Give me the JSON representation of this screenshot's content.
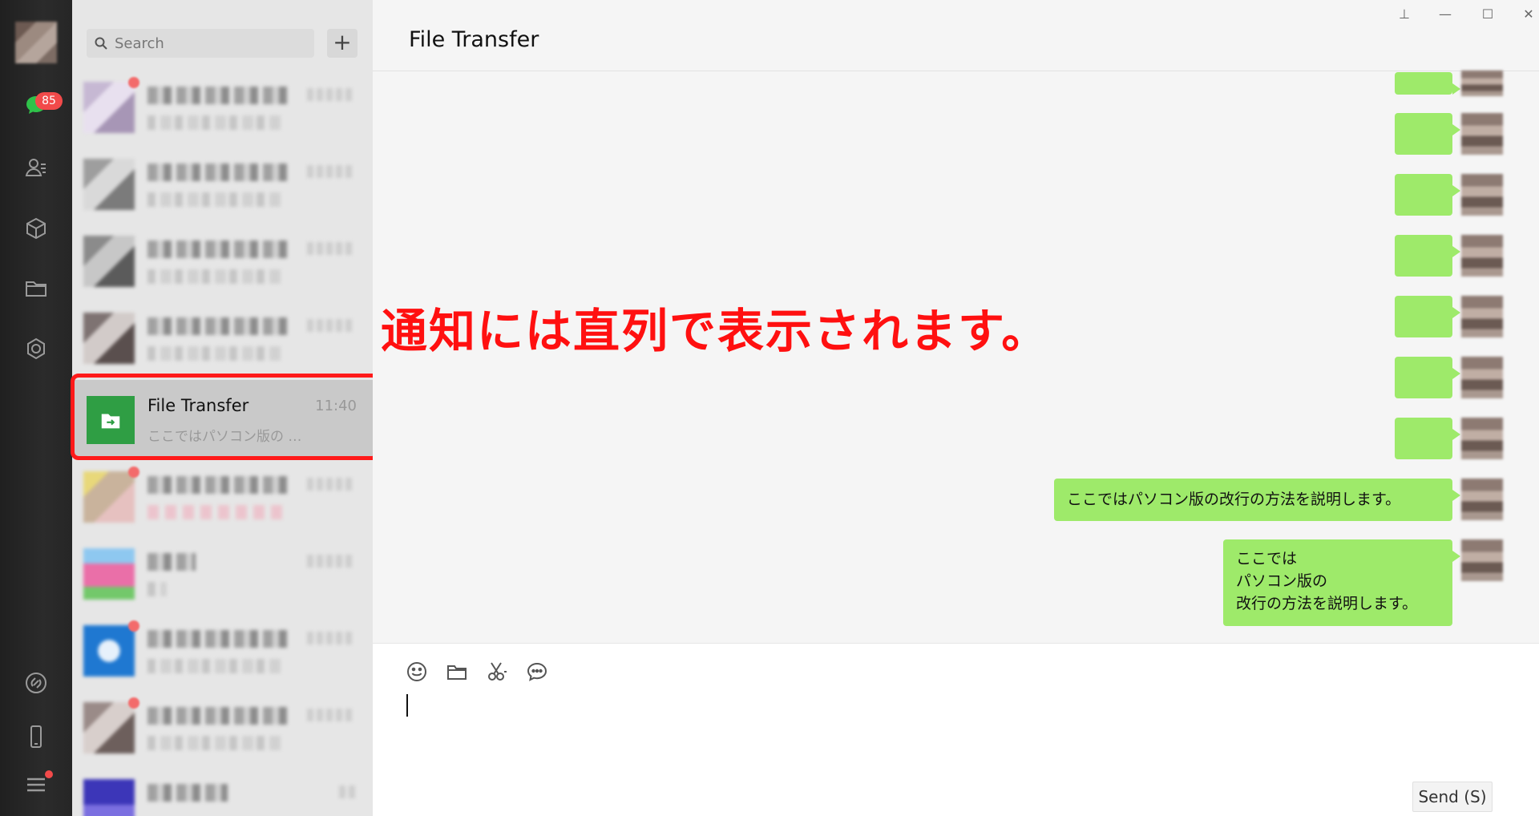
{
  "rail": {
    "unread_count": "85",
    "icons": [
      "chat-icon",
      "contacts-icon",
      "cube-icon",
      "folder-icon",
      "mini-program-icon",
      "link-icon",
      "phone-icon",
      "menu-icon"
    ]
  },
  "search": {
    "placeholder": "Search",
    "add_label": "+"
  },
  "chat_list": {
    "selected": {
      "name": "File Transfer",
      "time": "11:40",
      "preview": "ここではパソコン版の …"
    }
  },
  "chat": {
    "title": "File Transfer",
    "annotation": "通知には直列で表示されます。",
    "messages": [
      "ここではパソコン版の改行の方法を説明します。",
      "ここでは\nパソコン版の\n改行の方法を説明します。"
    ],
    "multiline_lines": [
      "ここでは",
      "パソコン版の",
      "改行の方法を説明します。"
    ]
  },
  "composer": {
    "send_label": "Send (S)"
  },
  "window": {
    "pin": "⊥",
    "minimize": "—",
    "maximize": "☐",
    "close": "✕"
  },
  "colors": {
    "accent_green": "#9eea6a",
    "file_transfer_green": "#2f9e44",
    "highlight_red": "#ff1a1a",
    "badge_red": "#f24a4a"
  }
}
